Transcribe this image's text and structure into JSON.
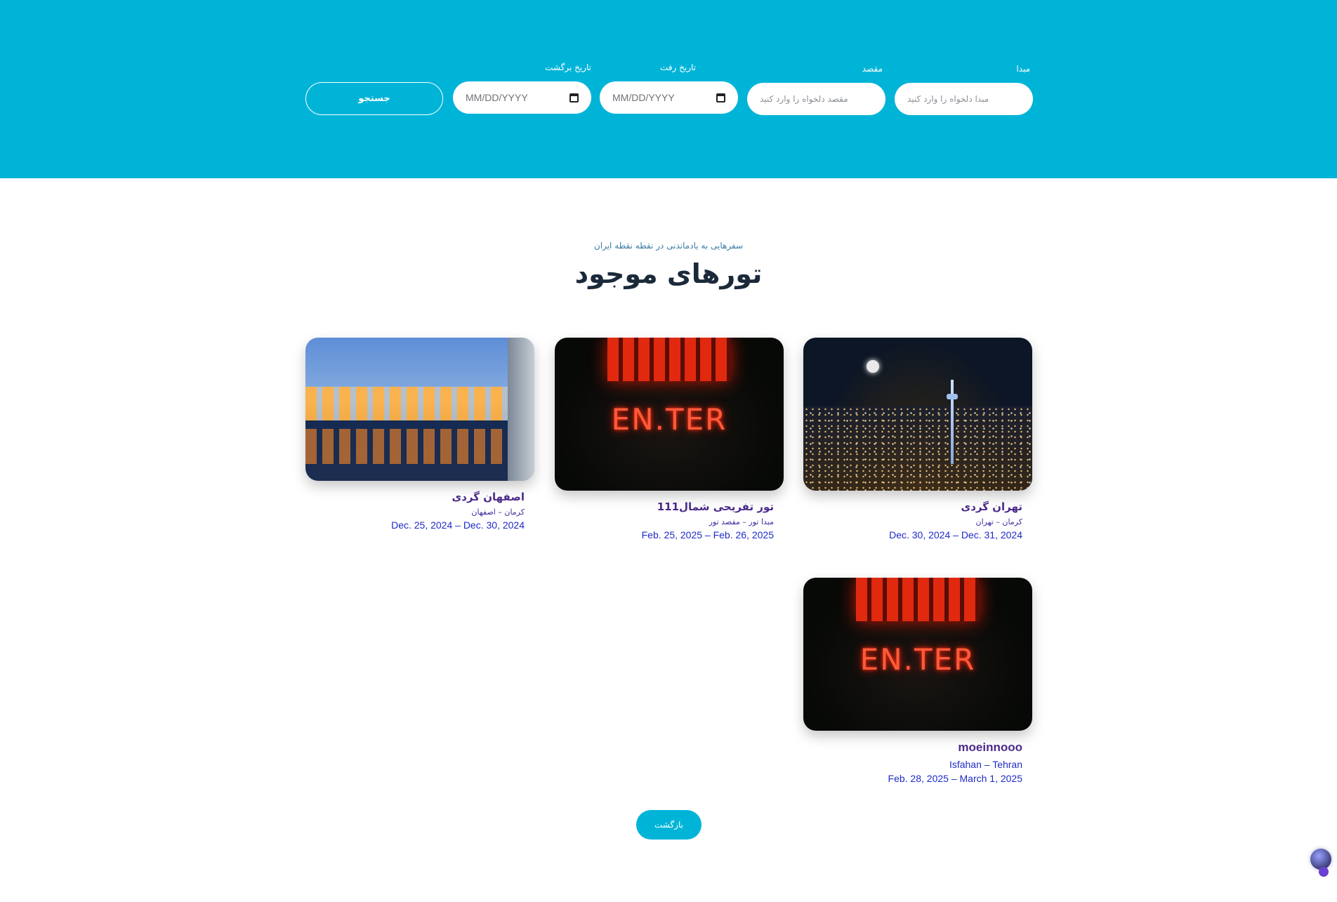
{
  "search": {
    "origin_label": "مبدا",
    "origin_placeholder": "مبدا دلخواه را وارد کنید",
    "destination_label": "مقصد",
    "destination_placeholder": "مقصد دلخواه را وارد کنید",
    "depart_label": "تاریخ رفت",
    "depart_placeholder": "MM/DD/YYYY",
    "return_label": "تاریخ برگشت",
    "return_placeholder": "MM/DD/YYYY",
    "search_button": "جستجو"
  },
  "section": {
    "subtitle": "سفرهایی به یادماندنی در نقطه نقطه ایران",
    "title": "تورهای موجود"
  },
  "tours": [
    {
      "name": "تهران گردی",
      "route": "کرمان – تهران",
      "dates": "Dec. 30, 2024 – Dec. 31, 2024",
      "image": "tehran-night-city"
    },
    {
      "name": "تور تفریحی شمال111",
      "route": "مبدا تور – مقصد تور",
      "dates": "Feb. 25, 2025 – Feb. 26, 2025",
      "image": "neon-enter-sign"
    },
    {
      "name": "اصفهان گردی",
      "route": "کرمان – اصفهان",
      "dates": "Dec. 25, 2024 – Dec. 30, 2024",
      "image": "isfahan-bridge"
    },
    {
      "name": "moeinnooo",
      "route": "Isfahan – Tehran",
      "dates": "Feb. 28, 2025 – March 1, 2025",
      "image": "neon-enter-sign"
    }
  ],
  "neon_text": "EN.TER",
  "back_button": "بازگشت",
  "colors": {
    "accent": "#00b4d8",
    "title": "#1b2a3a",
    "tour_name": "#4b2b8a",
    "dates": "#1f2ac8"
  }
}
